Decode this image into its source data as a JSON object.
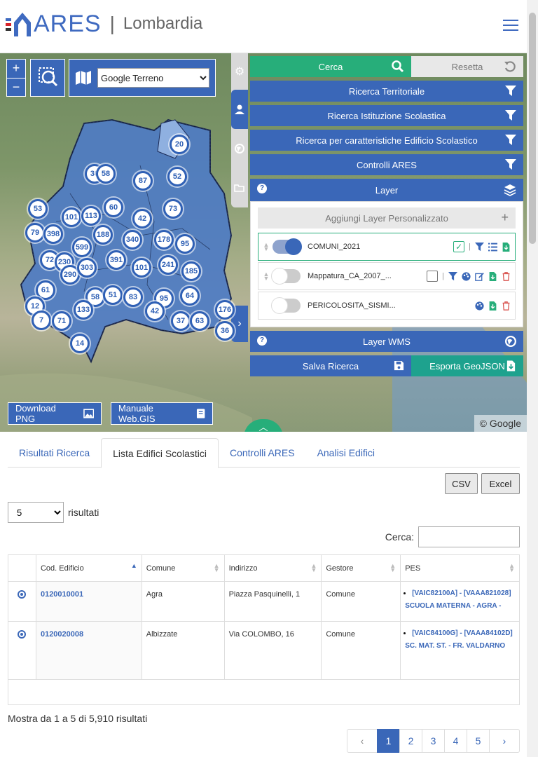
{
  "header": {
    "brand": "ARES",
    "region": "Lombardia"
  },
  "map": {
    "zoom_in": "+",
    "zoom_out": "−",
    "basemap_selected": "Google Terreno",
    "download_png": "Download PNG",
    "manuale": "Manuale Web.GIS",
    "credit": "© Google",
    "clusters": [
      "20",
      "30",
      "58",
      "87",
      "52",
      "53",
      "101",
      "113",
      "60",
      "73",
      "79",
      "398",
      "188",
      "42",
      "340",
      "178",
      "95",
      "599",
      "72",
      "230",
      "290",
      "303",
      "391",
      "101",
      "241",
      "185",
      "61",
      "58",
      "51",
      "83",
      "95",
      "64",
      "12",
      "133",
      "42",
      "176",
      "7",
      "71",
      "37",
      "63",
      "36",
      "14"
    ]
  },
  "panel": {
    "cerca": "Cerca",
    "resetta": "Resetta",
    "filters": [
      "Ricerca Territoriale",
      "Ricerca Istituzione Scolastica",
      "Ricerca per caratteristiche Edificio Scolastico",
      "Controlli ARES"
    ],
    "layer_title": "Layer",
    "add_layer": "Aggiungi Layer Personalizzato",
    "layers": [
      "COMUNI_2021",
      "Mappatura_CA_2007_...",
      "PERICOLOSITA_SISMI..."
    ],
    "layer_wms": "Layer WMS",
    "salva": "Salva Ricerca",
    "esporta": "Esporta GeoJSON"
  },
  "tabs": [
    "Risultati Ricerca",
    "Lista Edifici Scolastici",
    "Controlli ARES",
    "Analisi Edifici"
  ],
  "toolbar": {
    "csv": "CSV",
    "excel": "Excel",
    "length_value": "5",
    "length_suffix": "risultati",
    "search_label": "Cerca:"
  },
  "table": {
    "columns": [
      "",
      "Cod. Edificio",
      "Comune",
      "Indirizzo",
      "Gestore",
      "PES"
    ],
    "rows": [
      {
        "code": "0120010001",
        "comune": "Agra",
        "indirizzo": "Piazza Pasquinelli, 1",
        "gestore": "Comune",
        "pes_1": "[VAIC82100A] - [VAAA821028]",
        "pes_2": "SCUOLA MATERNA - AGRA -"
      },
      {
        "code": "0120020008",
        "comune": "Albizzate",
        "indirizzo": "Via COLOMBO, 16",
        "gestore": "Comune",
        "pes_1": "[VAIC84100G] - [VAAA84102D]",
        "pes_2": "SC. MAT. ST. - FR. VALDARNO"
      }
    ]
  },
  "info": "Mostra da 1 a 5 di 5,910 risultati",
  "pager": [
    "‹",
    "1",
    "2",
    "3",
    "4",
    "5",
    "›"
  ]
}
